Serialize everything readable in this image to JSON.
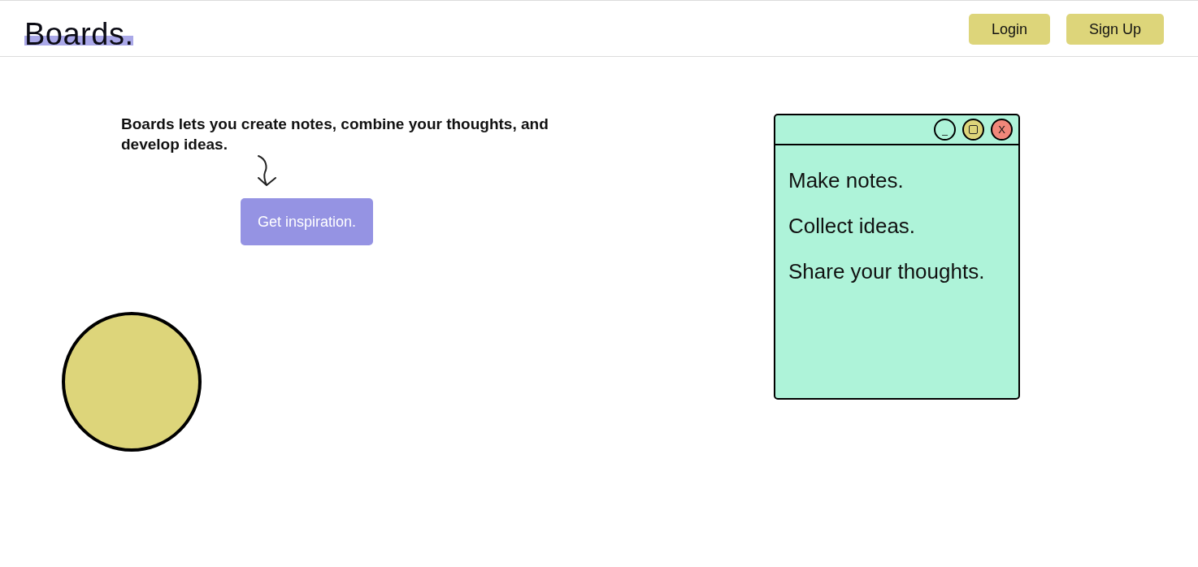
{
  "header": {
    "logo": "Boards.",
    "buttons": [
      {
        "label": "Login"
      },
      {
        "label": "Sign Up"
      }
    ]
  },
  "hero": {
    "tagline": "Boards lets you create notes, combine your thoughts, and develop ideas.",
    "cta": "Get inspiration."
  },
  "note_window": {
    "controls": [
      {
        "kind": "minimize",
        "label": "_",
        "color": "#aef3d9"
      },
      {
        "kind": "maximize",
        "color": "#ddd57a"
      },
      {
        "kind": "close",
        "label": "X",
        "color": "#f0877a"
      }
    ],
    "lines": [
      "Make notes.",
      "Collect ideas.",
      "Share your thoughts."
    ]
  }
}
